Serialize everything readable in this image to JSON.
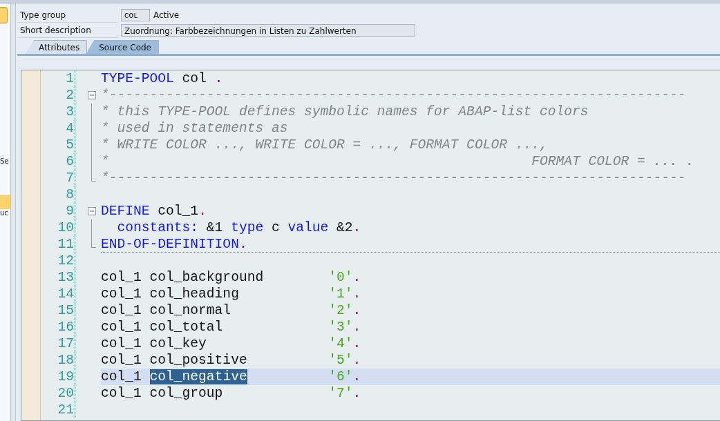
{
  "side_panel": {
    "fragments": [
      "Se",
      "uc"
    ]
  },
  "header": {
    "type_group": {
      "label": "Type group",
      "value": "COL",
      "status": "Active"
    },
    "short_description": {
      "label": "Short description",
      "value": "Zuordnung: Farbbezeichnungen in Listen zu Zahlwerten"
    }
  },
  "tabs": [
    {
      "label": "Attributes",
      "selected": false
    },
    {
      "label": "Source Code",
      "selected": true
    }
  ],
  "editor": {
    "lines": [
      {
        "number": "1",
        "kind": "plain",
        "current": false,
        "tokens": [
          {
            "kind": "keyword",
            "text": "TYPE-POOL"
          },
          {
            "kind": "text",
            "text": " col "
          },
          {
            "kind": "punct",
            "text": "."
          }
        ]
      },
      {
        "number": "2",
        "kind": "fold_start",
        "current": false,
        "tokens": [
          {
            "kind": "comment",
            "text": "*-----------------------------------------------------------------------"
          }
        ]
      },
      {
        "number": "3",
        "kind": "fold_body",
        "current": false,
        "tokens": [
          {
            "kind": "comment",
            "text": "* this TYPE-POOL defines symbolic names for ABAP-list colors"
          }
        ]
      },
      {
        "number": "4",
        "kind": "fold_body",
        "current": false,
        "tokens": [
          {
            "kind": "comment",
            "text": "* used in statements as"
          }
        ]
      },
      {
        "number": "5",
        "kind": "fold_body",
        "current": false,
        "tokens": [
          {
            "kind": "comment",
            "text": "* WRITE COLOR ..., WRITE COLOR = ..., FORMAT COLOR ...,"
          }
        ]
      },
      {
        "number": "6",
        "kind": "fold_body",
        "current": false,
        "tokens": [
          {
            "kind": "comment",
            "text": "*                                                    FORMAT COLOR = ... ."
          }
        ]
      },
      {
        "number": "7",
        "kind": "fold_end",
        "current": false,
        "tokens": [
          {
            "kind": "comment",
            "text": "*-----------------------------------------------------------------------"
          }
        ]
      },
      {
        "number": "8",
        "kind": "plain",
        "current": false
      },
      {
        "number": "9",
        "kind": "fold_start",
        "current": false,
        "tokens": [
          {
            "kind": "keyword",
            "text": "DEFINE"
          },
          {
            "kind": "text",
            "text": " col_1"
          },
          {
            "kind": "punct",
            "text": "."
          }
        ]
      },
      {
        "number": "10",
        "kind": "fold_body",
        "current": false,
        "indented": true,
        "tokens": [
          {
            "kind": "keyword",
            "text": "constants:"
          },
          {
            "kind": "text",
            "text": " &1 "
          },
          {
            "kind": "keyword",
            "text": "type"
          },
          {
            "kind": "text",
            "text": " c "
          },
          {
            "kind": "keyword",
            "text": "value"
          },
          {
            "kind": "text",
            "text": " &2"
          },
          {
            "kind": "punct",
            "text": "."
          }
        ]
      },
      {
        "number": "11",
        "kind": "fold_end",
        "current": false,
        "separator_after": true,
        "tokens": [
          {
            "kind": "keyword",
            "text": "END-OF-DEFINITION"
          },
          {
            "kind": "punct",
            "text": "."
          }
        ]
      },
      {
        "number": "12",
        "kind": "plain",
        "current": false
      },
      {
        "number": "13",
        "kind": "plain",
        "current": false,
        "tokens": [
          {
            "kind": "text",
            "text": "col_1 col_background        "
          },
          {
            "kind": "string",
            "text": "'0'"
          },
          {
            "kind": "punct",
            "text": "."
          }
        ]
      },
      {
        "number": "14",
        "kind": "plain",
        "current": false,
        "tokens": [
          {
            "kind": "text",
            "text": "col_1 col_heading           "
          },
          {
            "kind": "string",
            "text": "'1'"
          },
          {
            "kind": "punct",
            "text": "."
          }
        ]
      },
      {
        "number": "15",
        "kind": "plain",
        "current": false,
        "tokens": [
          {
            "kind": "text",
            "text": "col_1 col_normal            "
          },
          {
            "kind": "string",
            "text": "'2'"
          },
          {
            "kind": "punct",
            "text": "."
          }
        ]
      },
      {
        "number": "16",
        "kind": "plain",
        "current": false,
        "tokens": [
          {
            "kind": "text",
            "text": "col_1 col_total             "
          },
          {
            "kind": "string",
            "text": "'3'"
          },
          {
            "kind": "punct",
            "text": "."
          }
        ]
      },
      {
        "number": "17",
        "kind": "plain",
        "current": false,
        "tokens": [
          {
            "kind": "text",
            "text": "col_1 col_key               "
          },
          {
            "kind": "string",
            "text": "'4'"
          },
          {
            "kind": "punct",
            "text": "."
          }
        ]
      },
      {
        "number": "18",
        "kind": "plain",
        "current": false,
        "tokens": [
          {
            "kind": "text",
            "text": "col_1 col_positive          "
          },
          {
            "kind": "string",
            "text": "'5'"
          },
          {
            "kind": "punct",
            "text": "."
          }
        ]
      },
      {
        "number": "19",
        "kind": "plain",
        "current": true,
        "tokens": [
          {
            "kind": "text",
            "text": "col_1 "
          },
          {
            "kind": "selection",
            "text": "col_negative"
          },
          {
            "kind": "string",
            "text": "          '6'"
          },
          {
            "kind": "punct",
            "text": "."
          }
        ]
      },
      {
        "number": "20",
        "kind": "plain",
        "current": false,
        "tokens": [
          {
            "kind": "text",
            "text": "col_1 col_group             "
          },
          {
            "kind": "string",
            "text": "'7'"
          },
          {
            "kind": "punct",
            "text": "."
          }
        ]
      },
      {
        "number": "21",
        "kind": "plain",
        "current": false
      }
    ]
  }
}
